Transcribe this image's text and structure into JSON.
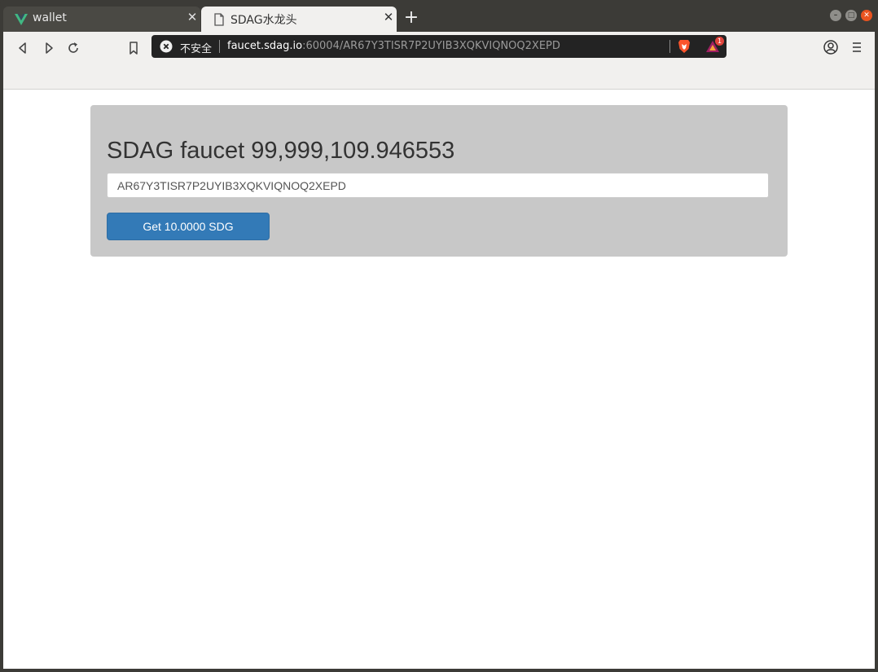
{
  "tabs": [
    {
      "label": "wallet",
      "icon": "vue-logo-icon",
      "active": false
    },
    {
      "label": "SDAG水龙头",
      "icon": "page-icon",
      "active": true
    }
  ],
  "addressbar": {
    "insecure_label": "不安全",
    "url_host": "faucet.sdag.io",
    "url_path": ":60004/AR67Y3TISR7P2UYIB3XQKVIQNOQ2XEPD",
    "rewards_badge": "1"
  },
  "page": {
    "title": "SDAG faucet 99,999,109.946553",
    "address_value": "AR67Y3TISR7P2UYIB3XQKVIQNOQ2XEPD",
    "button_label": "Get 10.0000 SDG"
  },
  "colors": {
    "panel_bg": "#c8c8c8",
    "button_bg": "#337ab7",
    "chrome_dark": "#3c3b37",
    "window_close": "#e95420"
  }
}
